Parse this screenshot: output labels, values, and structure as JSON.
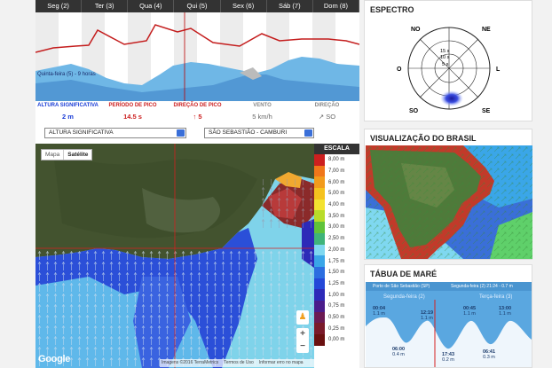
{
  "days": [
    "Seg (2)",
    "Ter (3)",
    "Qua (4)",
    "Qui (5)",
    "Sex (6)",
    "Sáb (7)",
    "Dom (8)"
  ],
  "forecast": {
    "cursor_label": "Quinta-feira (5) - 9 horas",
    "legend": [
      "ALTURA SIGNIFICATIVA",
      "PERÍODO DE PICO",
      "DIREÇÃO DE PICO",
      "VENTO",
      "DIREÇÃO"
    ],
    "values": [
      "2 m",
      "14.5 s",
      "5",
      "5 km/h",
      "SO"
    ],
    "colors": {
      "height": "#1a3cd6",
      "period": "#cc1f1f",
      "direction": "#cc1f1f",
      "wind": "#666",
      "wind_dir": "#666"
    }
  },
  "spectrum": {
    "title": "ESPECTRO",
    "cardinals": {
      "n": "NO",
      "ne": "NE",
      "w": "O",
      "e": "L",
      "sw": "SO",
      "se": "SE"
    },
    "rings": [
      "15 s",
      "10 s",
      "5 s"
    ]
  },
  "map": {
    "select_variable": "ALTURA SIGNIFICATIVA",
    "select_location": "SÃO SEBASTIÃO - CAMBURI",
    "tab_map": "Mapa",
    "tab_satellite": "Satélite",
    "attribution": "Imagens ©2016 TerraMetrics",
    "terms": "Termos de Uso",
    "report": "Informar erro no mapa",
    "google": "Google",
    "scale_title": "ESCALA",
    "scale": [
      {
        "label": "8,00 m",
        "color": "#cc1f1f"
      },
      {
        "label": "7,00 m",
        "color": "#f0761a"
      },
      {
        "label": "6,00 m",
        "color": "#f29b1c"
      },
      {
        "label": "5,00 m",
        "color": "#f5c21e"
      },
      {
        "label": "4,00 m",
        "color": "#f3e230"
      },
      {
        "label": "3,50 m",
        "color": "#b8dc2a"
      },
      {
        "label": "3,00 m",
        "color": "#60c33a"
      },
      {
        "label": "2,50 m",
        "color": "#3fb47a"
      },
      {
        "label": "2,00 m",
        "color": "#7fd8f0"
      },
      {
        "label": "1,75 m",
        "color": "#3aa6e8"
      },
      {
        "label": "1,50 m",
        "color": "#2c6ee0"
      },
      {
        "label": "1,25 m",
        "color": "#2448d8"
      },
      {
        "label": "1,00 m",
        "color": "#2d2ab8"
      },
      {
        "label": "0,75 m",
        "color": "#4a1c8a"
      },
      {
        "label": "0,50 m",
        "color": "#6b1a52"
      },
      {
        "label": "0,25 m",
        "color": "#7a1a2a"
      },
      {
        "label": "0,00 m",
        "color": "#6a1010"
      }
    ]
  },
  "brasil": {
    "title": "VISUALIZAÇÃO DO BRASIL"
  },
  "tide": {
    "title": "TÁBUA DE MARÉ",
    "header_left": "Porto de São Sebastião (SP)",
    "header_right": "Segunda-feira (2) 21:24 - 0.7 m",
    "day1": "Segunda-feira (2)",
    "day2": "Terça-feira (3)",
    "events": [
      {
        "time": "00:04",
        "value": "1.1 m"
      },
      {
        "time": "06:00",
        "value": "0.4 m"
      },
      {
        "time": "12:19",
        "value": "1.1 m"
      },
      {
        "time": "17:43",
        "value": "0.2 m"
      },
      {
        "time": "00:45",
        "value": "1.1 m"
      },
      {
        "time": "06:41",
        "value": "0.3 m"
      },
      {
        "time": "13:00",
        "value": "1.1 m"
      }
    ]
  }
}
